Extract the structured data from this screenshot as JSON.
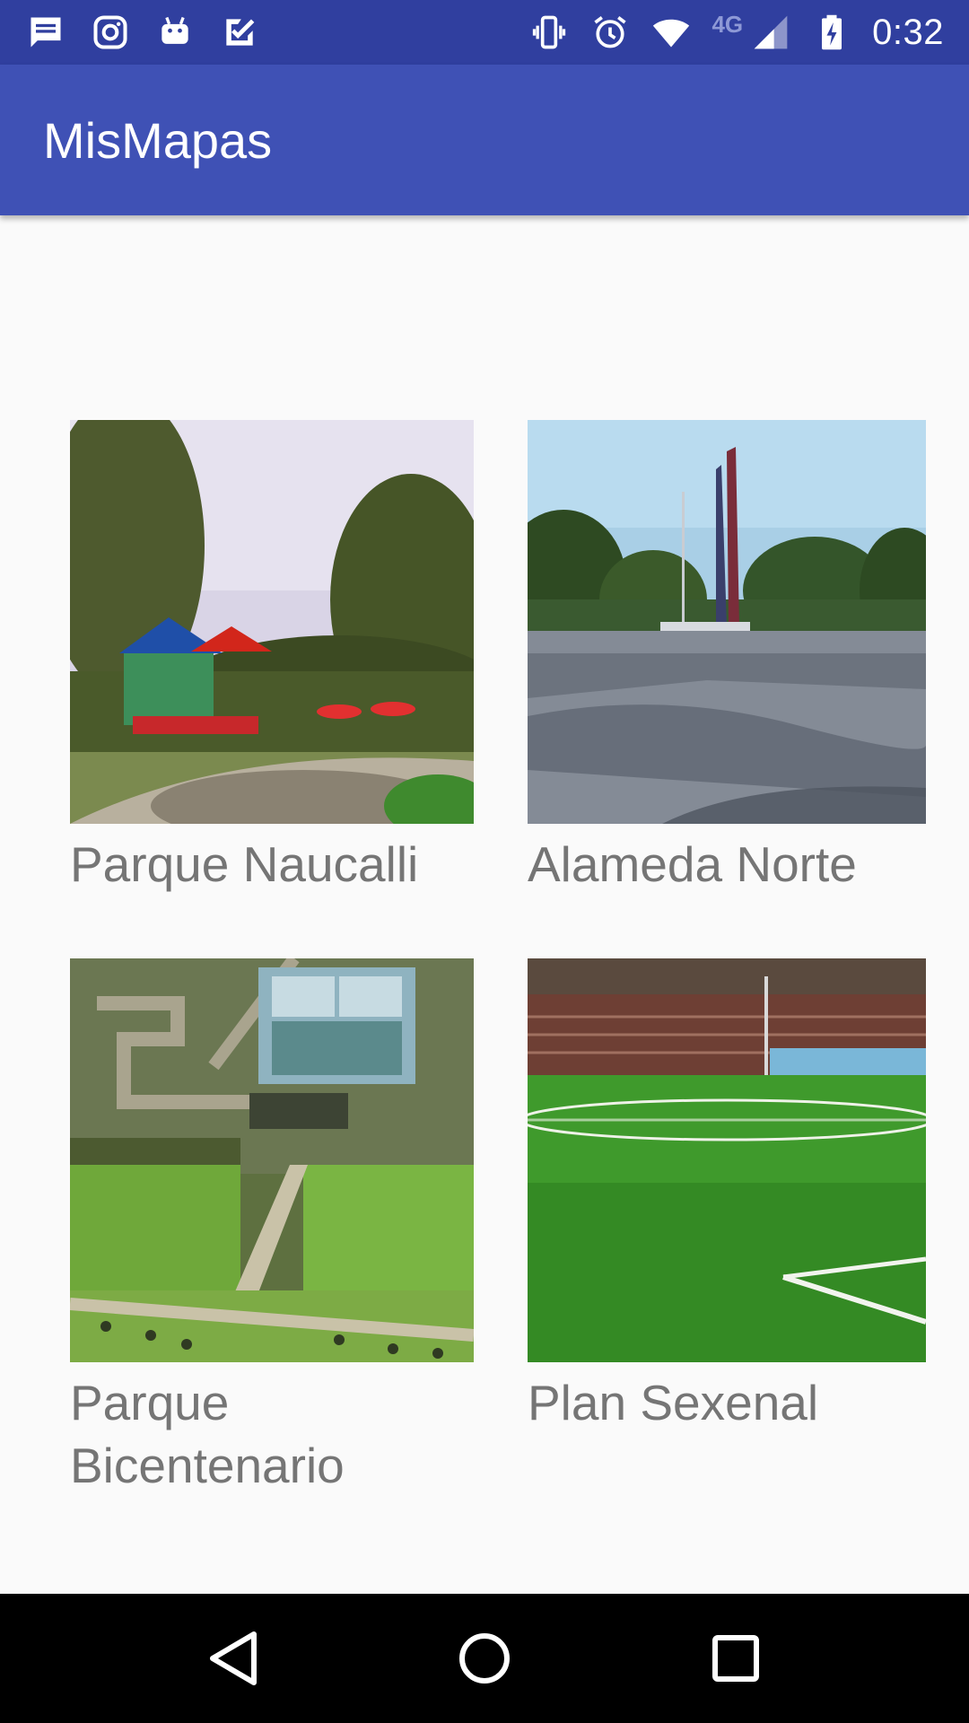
{
  "status_bar": {
    "time": "0:32",
    "network": "4G",
    "left_icons": [
      "message-icon",
      "instagram-icon",
      "android-icon",
      "tasks-icon"
    ],
    "right_icons": [
      "vibrate-icon",
      "alarm-icon",
      "wifi-icon",
      "signal-icon",
      "battery-charging-icon"
    ]
  },
  "app_bar": {
    "title": "MisMapas",
    "color": "#3f51b5",
    "status_color": "#303f9f"
  },
  "places": [
    {
      "name": "Parque Naucalli",
      "image": "playground-park-photo"
    },
    {
      "name": "Alameda Norte",
      "image": "plaza-monument-photo"
    },
    {
      "name": "Parque Bicentenario",
      "image": "garden-greenhouse-aerial-photo"
    },
    {
      "name": "Plan Sexenal",
      "image": "soccer-field-photo"
    }
  ],
  "nav_bar": {
    "buttons": [
      "back-icon",
      "home-icon",
      "recents-icon"
    ]
  }
}
